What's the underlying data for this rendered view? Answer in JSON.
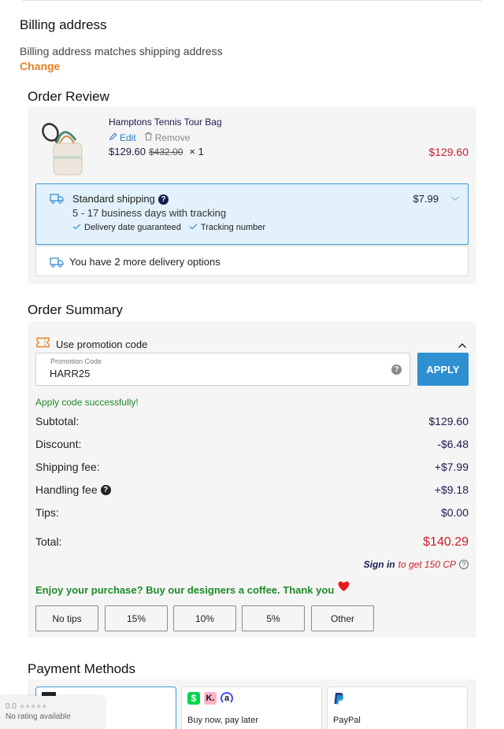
{
  "billing": {
    "title": "Billing address",
    "status": "Billing address matches shipping address",
    "change_label": "Change"
  },
  "order_review": {
    "title": "Order Review",
    "product": {
      "name": "Hamptons Tennis Tour Bag",
      "edit_label": "Edit",
      "remove_label": "Remove",
      "price": "$129.60",
      "original_price": "$432.00",
      "quantity": "× 1",
      "line_total": "$129.60"
    },
    "shipping": {
      "method": "Standard shipping",
      "price": "$7.99",
      "eta": "5 - 17 business days with tracking",
      "feature1": "Delivery date guaranteed",
      "feature2": "Tracking number",
      "more_options": "You have 2 more delivery options"
    }
  },
  "order_summary": {
    "title": "Order Summary",
    "promo_toggle": "Use promotion code",
    "promo_field_label": "Promotion Code",
    "promo_value": "HARR25",
    "apply_label": "APPLY",
    "apply_success": "Apply code successfully!",
    "subtotal_label": "Subtotal:",
    "subtotal_value": "$129.60",
    "discount_label": "Discount:",
    "discount_value": "-$6.48",
    "shipping_label": "Shipping fee:",
    "shipping_value": "+$7.99",
    "handling_label": "Handling fee",
    "handling_value": "+$9.18",
    "tips_label": "Tips:",
    "tips_value": "$0.00",
    "total_label": "Total:",
    "total_value": "$140.29",
    "signin_label": "Sign in",
    "signin_reward": "to get 150 CP",
    "coffee_message": "Enjoy your purchase? Buy our designers a coffee. Thank you",
    "tips": [
      "No tips",
      "15%",
      "10%",
      "5%",
      "Other"
    ]
  },
  "payment": {
    "title": "Payment Methods",
    "bnpl_label": "Buy now, pay later",
    "paypal_label": "PayPal"
  },
  "rating_badge": {
    "score": "0.0",
    "text": "No rating available"
  },
  "colors": {
    "accent_orange": "#e8801f",
    "apply_blue": "#2e8fd1",
    "price_red": "#c8202f",
    "shipping_bg": "#e2f1fb",
    "success_green": "#1f8a2a"
  }
}
